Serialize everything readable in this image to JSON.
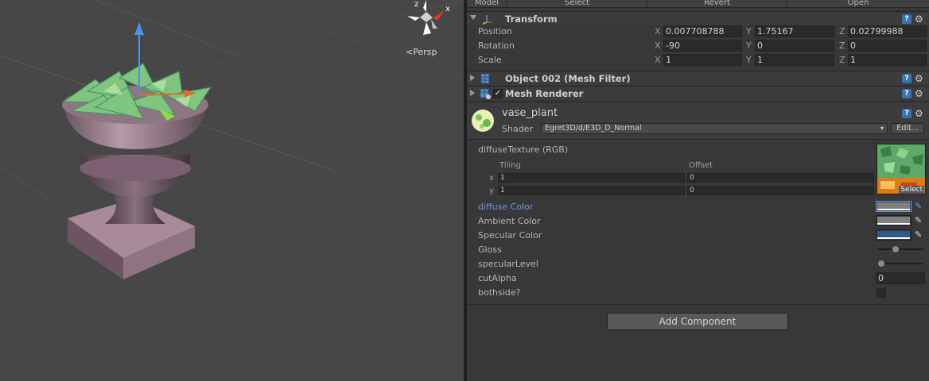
{
  "scene": {
    "projection_label": "Persp",
    "gizmo_axes": {
      "z": "z",
      "x": "x"
    }
  },
  "topbar": {
    "model_label": "Model",
    "select_label": "Select",
    "revert_label": "Revert",
    "open_label": "Open"
  },
  "transform": {
    "title": "Transform",
    "position": {
      "label": "Position",
      "x": "0.007708788",
      "y": "1.75167",
      "z": "0.02799988"
    },
    "rotation": {
      "label": "Rotation",
      "x": "-90",
      "y": "0",
      "z": "0"
    },
    "scale": {
      "label": "Scale",
      "x": "1",
      "y": "1",
      "z": "1"
    },
    "axis_x": "X",
    "axis_y": "Y",
    "axis_z": "Z"
  },
  "mesh_filter": {
    "title": "Object 002 (Mesh Filter)"
  },
  "mesh_renderer": {
    "title": "Mesh Renderer",
    "enabled": true
  },
  "material": {
    "name": "vase_plant",
    "shader_label": "Shader",
    "shader_value": "Egret3D/d/E3D_D_Normal",
    "edit_label": "Edit...",
    "texture": {
      "label": "diffuseTexture (RGB)",
      "tiling_label": "Tiling",
      "offset_label": "Offset",
      "x_label": "x",
      "y_label": "y",
      "tiling_x": "1",
      "tiling_y": "1",
      "offset_x": "0",
      "offset_y": "0",
      "select_label": "Select"
    },
    "properties": [
      {
        "label": "diffuse Color",
        "type": "color",
        "color": "#7f7f7f",
        "highlight": true
      },
      {
        "label": "Ambient Color",
        "type": "color",
        "color": "#808080"
      },
      {
        "label": "Specular Color",
        "type": "color",
        "color": "#2f5a8a"
      },
      {
        "label": "Gloss",
        "type": "slider",
        "value": 0.35
      },
      {
        "label": "specularLevel",
        "type": "slider",
        "value": 0.0
      },
      {
        "label": "cutAlpha",
        "type": "number",
        "value": "0"
      },
      {
        "label": "bothside?",
        "type": "toggle",
        "value": false
      }
    ]
  },
  "add_component_label": "Add Component",
  "colors": {
    "inspector_bg": "#383838",
    "scene_bg": "#474747",
    "highlight_label": "#6f96e8"
  }
}
